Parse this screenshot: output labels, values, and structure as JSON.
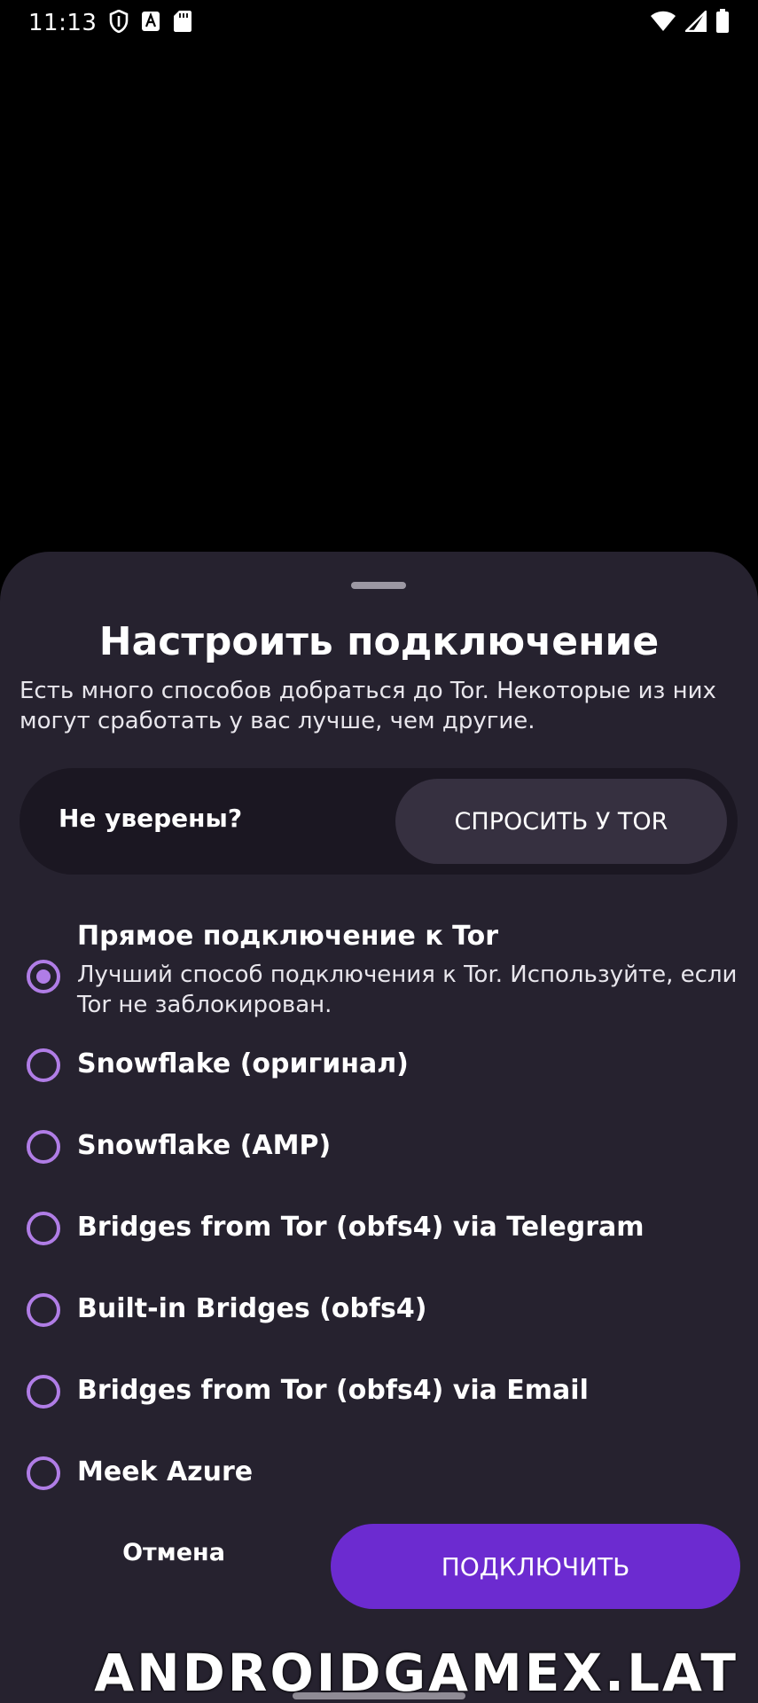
{
  "status_bar": {
    "time": "11:13",
    "icons": [
      "shield-icon",
      "font-a-icon",
      "sd-card-icon",
      "wifi-icon",
      "cellular-signal-icon",
      "battery-icon"
    ]
  },
  "sheet": {
    "title": "Настроить подключение",
    "description": "Есть много способов добраться до Tor. Некоторые из них могут сработать у вас лучше, чем другие.",
    "ask": {
      "label": "Не уверены?",
      "button": "СПРОСИТЬ У TOR"
    },
    "options": [
      {
        "title": "Прямое подключение к Tor",
        "subtitle": "Лучший способ подключения к Tor. Используйте, если Tor не заблокирован.",
        "selected": true
      },
      {
        "title": "Snowflake (оригинал)",
        "selected": false
      },
      {
        "title": "Snowflake (AMP)",
        "selected": false
      },
      {
        "title": "Bridges from Tor (obfs4) via Telegram",
        "selected": false
      },
      {
        "title": "Built-in Bridges (obfs4)",
        "selected": false
      },
      {
        "title": "Bridges from Tor (obfs4) via Email",
        "selected": false
      },
      {
        "title": "Meek Azure",
        "selected": false
      }
    ],
    "cancel": "Отмена",
    "connect": "ПОДКЛЮЧИТЬ"
  },
  "watermark": "ANDROIDGAMEX.LAT",
  "colors": {
    "sheet_bg": "#26222f",
    "accent": "#6c2bd0",
    "radio": "#b07de6"
  }
}
